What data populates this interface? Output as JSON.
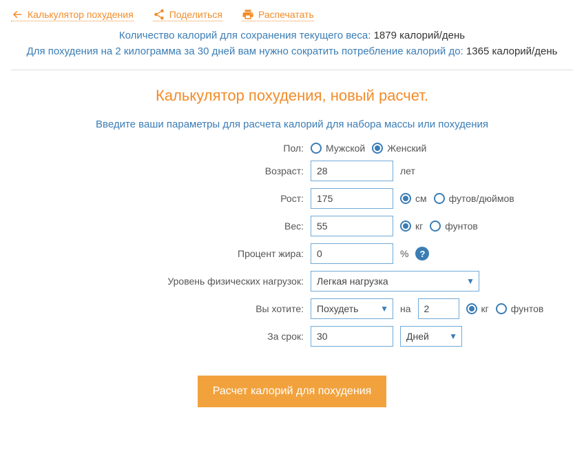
{
  "toplinks": {
    "calculator": "Калькулятор похудения",
    "share": "Поделиться",
    "print": "Распечатать"
  },
  "results": {
    "maintain_label": "Количество калорий для сохранения текущего веса:",
    "maintain_value": "1879 калорий/день",
    "lose_label": "Для похудения на 2 килограмма за 30 дней вам нужно сократить потребление калорий до:",
    "lose_value": "1365 калорий/день"
  },
  "heading": "Калькулятор похудения, новый расчет.",
  "subtitle": "Введите ваши параметры для расчета калорий для набора массы или похудения",
  "form": {
    "labels": {
      "gender": "Пол:",
      "age": "Возраст:",
      "height": "Рост:",
      "weight": "Вес:",
      "fat": "Процент жира:",
      "activity": "Уровень физических нагрузок:",
      "goal": "Вы хотите:",
      "period": "За срок:"
    },
    "gender": {
      "male": "Мужской",
      "female": "Женский"
    },
    "age": {
      "value": "28",
      "unit": "лет"
    },
    "height": {
      "value": "175",
      "unit_cm": "см",
      "unit_ft": "футов/дюймов"
    },
    "weight": {
      "value": "55",
      "unit_kg": "кг",
      "unit_lb": "фунтов"
    },
    "fat": {
      "value": "0",
      "unit": "%"
    },
    "activity": {
      "selected": "Легкая нагрузка"
    },
    "goal": {
      "selected": "Похудеть",
      "by_label": "на",
      "amount": "2",
      "unit_kg": "кг",
      "unit_lb": "фунтов"
    },
    "period": {
      "value": "30",
      "unit": "Дней"
    }
  },
  "submit": "Расчет калорий для похудения"
}
